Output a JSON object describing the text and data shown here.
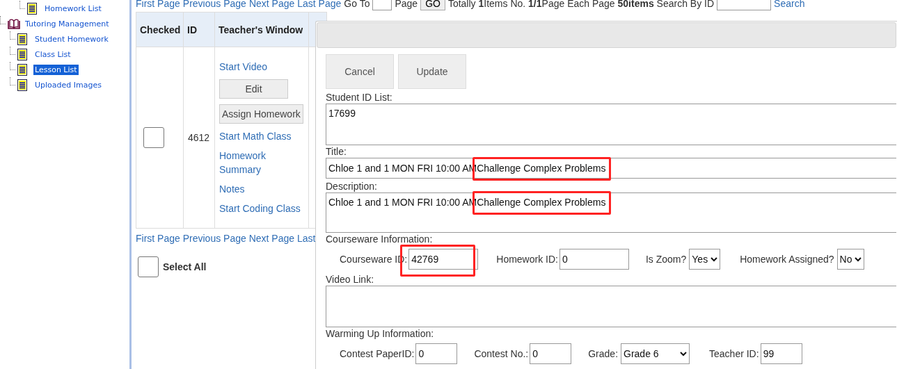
{
  "sidebar": {
    "continued_items": [
      {
        "label": "Homework List",
        "selected": false
      }
    ],
    "items": [
      {
        "label": "Tutoring Management",
        "selected": false,
        "children": [
          {
            "label": "Student Homework",
            "selected": false
          },
          {
            "label": "Class List",
            "selected": false
          },
          {
            "label": "Lesson List",
            "selected": true
          },
          {
            "label": "Uploaded Images",
            "selected": false
          }
        ]
      }
    ]
  },
  "pager_top": {
    "links": [
      "First Page",
      "Previous Page",
      "Next Page",
      "Last Page"
    ],
    "goto_label": "Go To",
    "page_label": "Page",
    "go_button": "GO",
    "summary": "Totally **1**Items No. **1/1**Page Each Page **50items** Search By ID",
    "search_link": "Search"
  },
  "table": {
    "columns": [
      "Checked",
      "ID",
      "Teacher's Window"
    ],
    "rows": [
      {
        "checked": false,
        "id": "4612",
        "actions": [
          {
            "kind": "link",
            "label": "Start Video"
          },
          {
            "kind": "button",
            "label": "Edit"
          },
          {
            "kind": "button",
            "label": "Assign Homework"
          },
          {
            "kind": "link",
            "label": "Start Math Class"
          },
          {
            "kind": "link",
            "label": "Homework Summary"
          },
          {
            "kind": "link",
            "label": "Notes"
          },
          {
            "kind": "link",
            "label": "Start Coding Class"
          }
        ]
      }
    ]
  },
  "pager_bottom": {
    "links": [
      "First Page",
      "Previous Page",
      "Next Page",
      "Last"
    ]
  },
  "select_all": {
    "label": "Select All",
    "checked": false
  },
  "dialog": {
    "buttons": [
      "Cancel",
      "Update"
    ],
    "student_ids": {
      "label": "Student ID List:",
      "value": "17699"
    },
    "title": {
      "label": "Title:",
      "parts": [
        {
          "text": "Chloe 1 and 1 MON FRI 10:00 AM",
          "highlighted": false
        },
        {
          "text": "Challenge Complex Problems",
          "highlighted": true
        }
      ]
    },
    "description": {
      "label": "Description:",
      "parts": [
        {
          "text": "Chloe 1 and 1 MON FRI 10:00 AM",
          "highlighted": false
        },
        {
          "text": "Challenge Complex Problems",
          "highlighted": true
        }
      ]
    },
    "courseware": {
      "label": "Courseware Information:",
      "fields": [
        {
          "kind": "input",
          "label": "Courseware ID:",
          "value": "42769",
          "highlighted": true
        },
        {
          "kind": "input",
          "label": "Homework ID:",
          "value": "0",
          "highlighted": false
        },
        {
          "kind": "select",
          "label": "Is Zoom?",
          "value": "Yes"
        },
        {
          "kind": "select",
          "label": "Homework Assigned?",
          "value": "No"
        }
      ]
    },
    "video_link": {
      "label": "Video Link:"
    },
    "warming_up": {
      "label": "Warming Up Information:",
      "fields": [
        {
          "kind": "input",
          "label": "Contest PaperID:",
          "value": "0",
          "highlighted": false
        },
        {
          "kind": "input",
          "label": "Contest No.:",
          "value": "0",
          "highlighted": false
        },
        {
          "kind": "select",
          "label": "Grade:",
          "value": "Grade 6"
        },
        {
          "kind": "input",
          "label": "Teacher ID:",
          "value": "99",
          "highlighted": false
        }
      ]
    }
  }
}
